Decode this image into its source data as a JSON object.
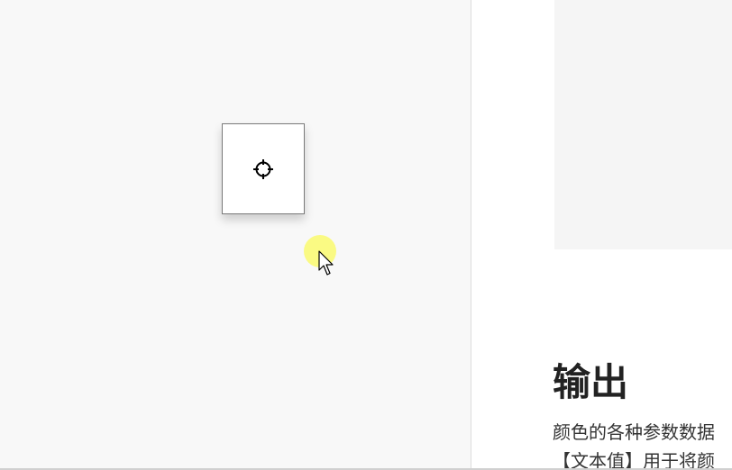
{
  "picker": {
    "icon": "crosshair-icon"
  },
  "cursor": {
    "icon": "mouse-pointer-icon",
    "highlight_color": "#f9f96e"
  },
  "doc": {
    "heading": "输出",
    "description_line1": "颜色的各种参数数据",
    "description_line2": "【文本值】用于将颜"
  }
}
